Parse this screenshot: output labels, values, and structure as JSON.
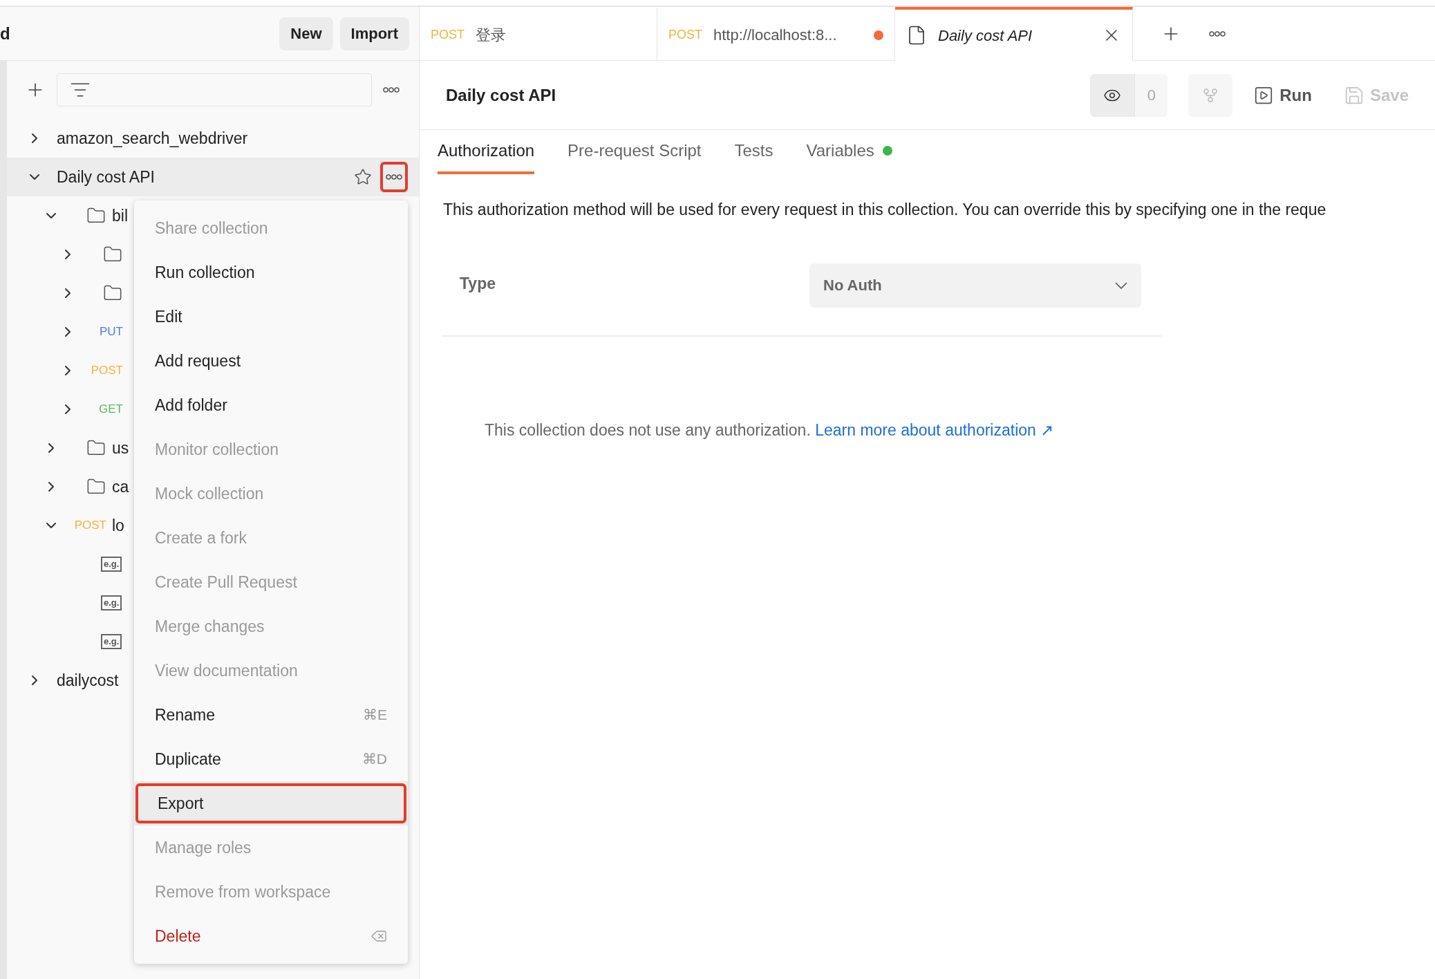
{
  "sidebar": {
    "header_title": "d",
    "buttons": [
      "New",
      "Import"
    ],
    "tree": [
      {
        "kind": "collection",
        "name": "amazon_search_webdriver",
        "expanded": false,
        "selected": false
      },
      {
        "kind": "collection",
        "name": "Daily cost API",
        "expanded": true,
        "selected": true,
        "starred": false,
        "more_highlighted": true,
        "children": [
          {
            "kind": "folder",
            "name": "bil",
            "expanded": true,
            "selected": false,
            "children": [
              {
                "kind": "folder",
                "expanded": false,
                "selected": false
              },
              {
                "kind": "folder",
                "expanded": false,
                "selected": false
              },
              {
                "kind": "request",
                "method": "PUT",
                "color": "#4a7ee8",
                "expanded": false,
                "selected": false
              },
              {
                "kind": "request",
                "method": "POST",
                "color": "#f4b23e",
                "expanded": false,
                "selected": false
              },
              {
                "kind": "request",
                "method": "GET",
                "color": "#5cb85c",
                "expanded": false,
                "selected": false
              }
            ]
          },
          {
            "kind": "folder",
            "name": "us",
            "expanded": false,
            "selected": false
          },
          {
            "kind": "folder",
            "name": "ca",
            "expanded": false,
            "selected": false
          },
          {
            "kind": "request",
            "method": "POST",
            "color": "#f4b23e",
            "name": "lo",
            "expanded": true,
            "selected": false,
            "children": [
              {
                "kind": "example",
                "tag": "e.g.",
                "selected": false
              },
              {
                "kind": "example",
                "tag": "e.g.",
                "selected": false
              },
              {
                "kind": "example",
                "tag": "e.g.",
                "selected": false
              }
            ]
          }
        ]
      },
      {
        "kind": "collection",
        "name": "dailycost",
        "expanded": false,
        "selected": false
      }
    ]
  },
  "context_menu": [
    {
      "label": "Share collection",
      "disabled": true,
      "highlighted": false
    },
    {
      "label": "Run collection",
      "disabled": false,
      "highlighted": false
    },
    {
      "label": "Edit",
      "disabled": false,
      "highlighted": false
    },
    {
      "label": "Add request",
      "disabled": false,
      "highlighted": false
    },
    {
      "label": "Add folder",
      "disabled": false,
      "highlighted": false
    },
    {
      "label": "Monitor collection",
      "disabled": true,
      "highlighted": false
    },
    {
      "label": "Mock collection",
      "disabled": true,
      "highlighted": false
    },
    {
      "label": "Create a fork",
      "disabled": true,
      "highlighted": false
    },
    {
      "label": "Create Pull Request",
      "disabled": true,
      "highlighted": false
    },
    {
      "label": "Merge changes",
      "disabled": true,
      "highlighted": false
    },
    {
      "label": "View documentation",
      "disabled": true,
      "highlighted": false
    },
    {
      "label": "Rename",
      "shortcut": "⌘E",
      "disabled": false,
      "highlighted": false
    },
    {
      "label": "Duplicate",
      "shortcut": "⌘D",
      "disabled": false,
      "highlighted": false
    },
    {
      "label": "Export",
      "disabled": false,
      "highlighted": true
    },
    {
      "label": "Manage roles",
      "disabled": true,
      "highlighted": false
    },
    {
      "label": "Remove from workspace",
      "disabled": true,
      "highlighted": false
    },
    {
      "label": "Delete",
      "kind": "danger",
      "disabled": false,
      "highlighted": false
    }
  ],
  "tabs": [
    {
      "method": "POST",
      "title": "登录",
      "unsaved": false,
      "selected": false
    },
    {
      "method": "POST",
      "title": "http://localhost:8...",
      "unsaved": true,
      "selected": false
    },
    {
      "title": "Daily cost API",
      "unsaved": false,
      "selected": true
    }
  ],
  "header": {
    "title": "Daily cost API",
    "watch_count": "0",
    "run": "Run",
    "save": "Save"
  },
  "subtabs": [
    {
      "label": "Authorization",
      "selected": true,
      "indicator": false
    },
    {
      "label": "Pre-request Script",
      "selected": false,
      "indicator": false
    },
    {
      "label": "Tests",
      "selected": false,
      "indicator": false
    },
    {
      "label": "Variables",
      "selected": false,
      "indicator": true
    }
  ],
  "auth": {
    "description": "This authorization method will be used for every request in this collection. You can override this by specifying one in the reque",
    "type_label": "Type",
    "type_value": "No Auth",
    "notice": "This collection does not use any authorization.",
    "link": "Learn more about authorization ↗"
  }
}
